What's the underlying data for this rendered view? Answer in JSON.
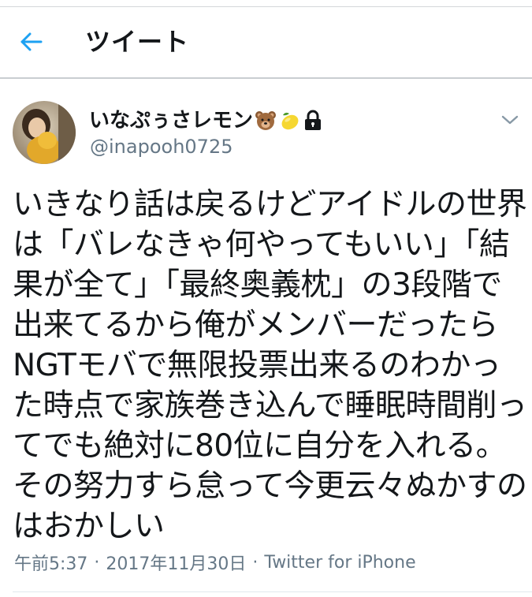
{
  "header": {
    "title": "ツイート",
    "back_icon": "arrow-left-icon"
  },
  "tweet": {
    "display_name": "いなぷぅさレモン",
    "name_emojis": [
      "bear-face-icon",
      "lemon-icon"
    ],
    "protected_icon": "lock-icon",
    "username": "@inapooh0725",
    "menu_icon": "chevron-down-icon",
    "text_lines": [
      "いきなり話は戻るけどアイドルの世界",
      "は「バレなきゃ何やってもいい」「結",
      "果が全て」「最終奥義枕」の3段階で",
      "出来てるから俺がメンバーだったら",
      "NGTモバで無限投票出来るのわかっ",
      "た時点で家族巻き込んで睡眠時間削っ",
      "てでも絶対に80位に自分を入れる。",
      "その努力すら怠って今更云々ぬかすの",
      "はおかしい"
    ],
    "time": "午前5:37",
    "separator": "·",
    "date": "2017年11月30日",
    "source": "Twitter for iPhone"
  },
  "colors": {
    "accent": "#1da1f2",
    "text": "#14171a",
    "secondary_text": "#657786",
    "divider": "#c9cdd1"
  }
}
